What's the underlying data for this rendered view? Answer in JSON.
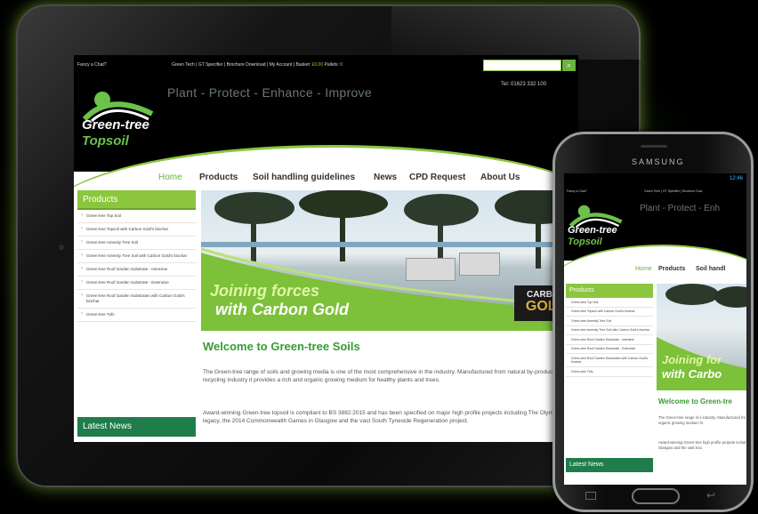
{
  "tablet_site": {
    "topbar": {
      "chat": "Fancy a Chat?",
      "links": "Green Tech | GT Specifier | Brochure Download | My Account | Basket: ",
      "basket": "£0.00",
      "pallets_label": " Pallets: ",
      "pallets": "0"
    },
    "logo": {
      "line1": "Green-tree",
      "line2": "Topsoil"
    },
    "tagline": "Plant - Protect - Enhance - Improve",
    "tel": "Tel: 01623 332 100",
    "nav": [
      "Home",
      "Products",
      "Soil handling guidelines",
      "News",
      "CPD Request",
      "About Us"
    ],
    "sidebar": {
      "title": "Products",
      "items": [
        "Green-tree Top Soil",
        "Green-tree Topsoil with Carbon Gold's biochar",
        "Green-tree Amenity Tree Soil",
        "Green-tree Amenity Tree Soil with Carbon Gold's biochar",
        "Green-tree Roof Garden Substrate - Intensive",
        "Green-tree Roof Garden Substrate - Extensive",
        "Green-tree Roof Garden Substrates with Carbon Gold's biochar",
        "Green-tree Tufs"
      ],
      "news_title": "Latest News"
    },
    "hero": {
      "line1": "Joining forces",
      "line2": "with Carbon Gold",
      "badge1": "CARBON",
      "badge2": "GOLD"
    },
    "welcome": "Welcome to Green-tree Soils",
    "para1": "The Green-tree range of soils and growing media is one of the most comprehensive in the industry. Manufactured from natural by-products of the recycling industry it provides a rich and organic growing medium for healthy plants and trees.",
    "para2": "Award-winning Green-tree topsoil is compliant to BS 3882:2015 and has been specified on major high profile projects including The Olympic Park legacy, the 2014 Commonwealth Games in Glasgow and the vast South Tyneside Regeneration project."
  },
  "phone_site": {
    "brand": "SAMSUNG",
    "status": "12:46",
    "topbar_chat": "Fancy a Chat?",
    "topbar_links": "Green Tech | GT Specifier | Brochure Dow",
    "logo": {
      "line1": "Green-tree",
      "line2": "Topsoil"
    },
    "tagline": "Plant - Protect - Enh",
    "nav": [
      "Home",
      "Products",
      "Soil handl"
    ],
    "sidebar": {
      "title": "Products",
      "items": [
        "Green-tree Top Soil",
        "Green-tree Topsoil with Carbon Gold's biochar",
        "Green-tree Amenity Tree Soil",
        "Green-tree Amenity Tree Soil with Carbon Gold's biochar",
        "Green-tree Roof Garden Substrate - Intensive",
        "Green-tree Roof Garden Substrate - Extensive",
        "Green-tree Roof Garden Substrates with Carbon Gold's biochar",
        "Green-tree Tufs"
      ],
      "news_title": "Latest News"
    },
    "hero": {
      "line1": "Joining for",
      "line2": "with Carbo"
    },
    "welcome": "Welcome to Green-tre",
    "para1": "The Green-tree range of s industry. Manufactured fro organic growing medium fo",
    "para2": "Award-winning Green-tree high profile projects includ Glasgow and the vast Sou"
  },
  "colors": {
    "brand_green": "#8cc63f",
    "dark_green": "#1e7d4a",
    "text_green": "#3a9a36"
  }
}
